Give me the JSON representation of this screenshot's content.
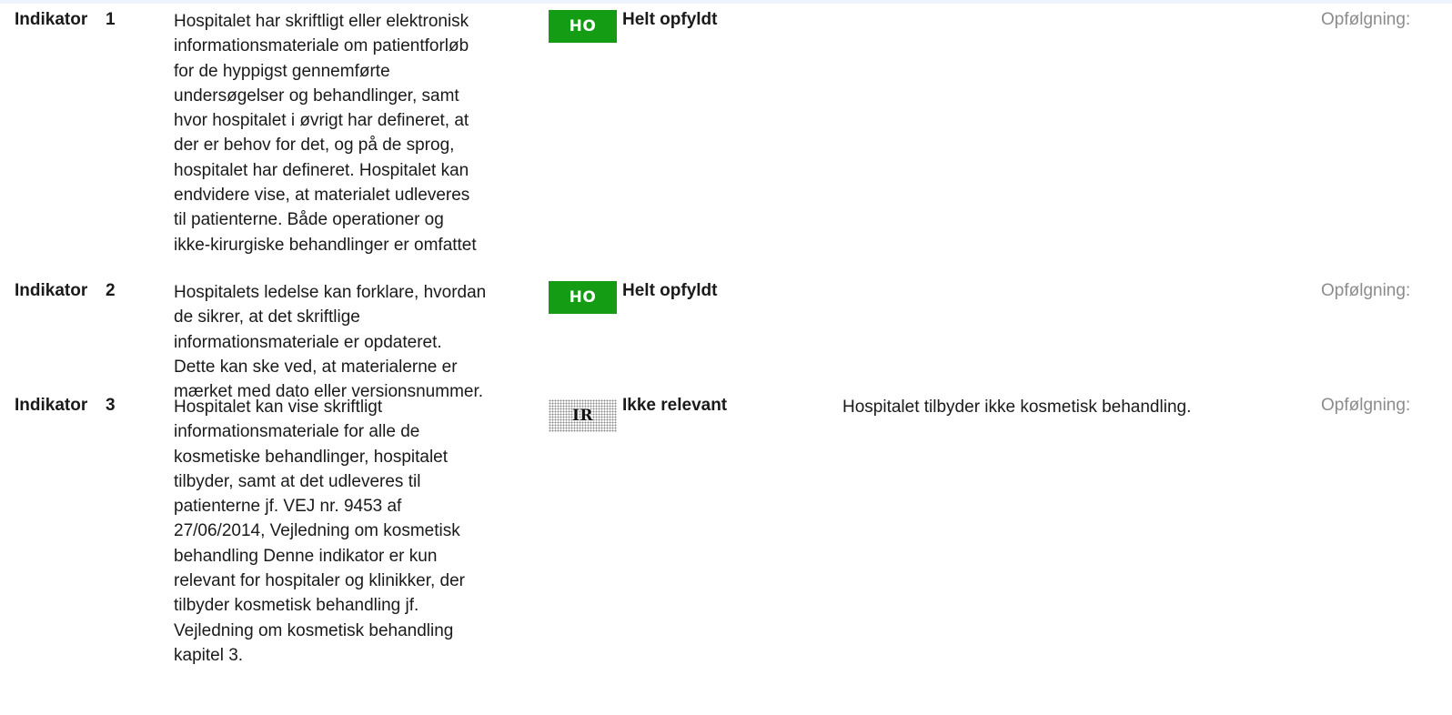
{
  "indicators": [
    {
      "label": "Indikator",
      "number": "1",
      "description": "Hospitalet har skriftligt eller elektronisk\ninformationsmateriale om patientforløb\nfor de hyppigst gennemførte\nundersøgelser og behandlinger, samt\nhvor hospitalet i øvrigt har defineret, at\nder er behov for det, og på de sprog,\nhospitalet har defineret. Hospitalet kan\nendvidere vise, at materialet udleveres\ntil patienterne.   Både operationer og\nikke-kirurgiske behandlinger er omfattet",
      "badge": "HO",
      "status": "Helt opfyldt",
      "comment": "",
      "followup": "Opfølgning:"
    },
    {
      "label": "Indikator",
      "number": "2",
      "description": "Hospitalets ledelse kan forklare, hvordan\nde sikrer, at det skriftlige\ninformationsmateriale er opdateret.\nDette kan ske ved, at materialerne er\nmærket med dato eller versionsnummer.",
      "badge": "HO",
      "status": "Helt opfyldt",
      "comment": "",
      "followup": "Opfølgning:"
    },
    {
      "label": "Indikator",
      "number": "3",
      "description": "Hospitalet kan vise skriftligt\ninformationsmateriale for alle de\nkosmetiske behandlinger, hospitalet\ntilbyder, samt at det udleveres til\npatienterne jf. VEJ nr. 9453 af\n27/06/2014, Vejledning om kosmetisk\nbehandling     Denne indikator er kun\nrelevant for hospitaler og klinikker, der\ntilbyder kosmetisk behandling jf.\nVejledning om kosmetisk behandling\nkapitel 3.",
      "badge": "IR",
      "status": "Ikke relevant",
      "comment": "Hospitalet tilbyder ikke kosmetisk behandling.",
      "followup": "Opfølgning:"
    }
  ],
  "colors": {
    "ho_badge": "#149c14",
    "followup_text": "#8c8c8c"
  }
}
